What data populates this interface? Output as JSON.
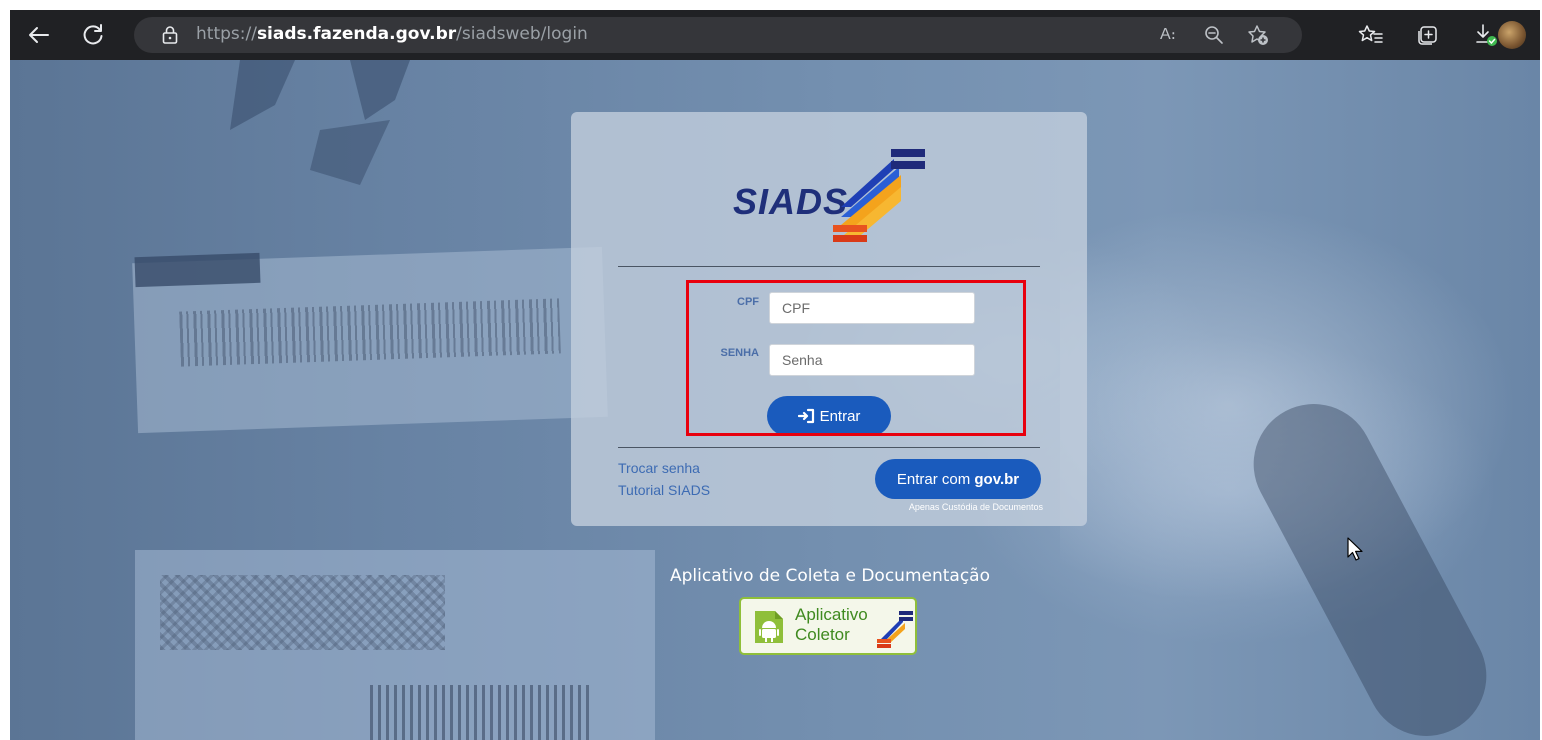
{
  "browser": {
    "url_scheme": "https://",
    "url_host": "siads.fazenda.gov.br",
    "url_path": "/siadsweb/login",
    "icons": {
      "back": "arrow-left-icon",
      "reload": "reload-icon",
      "lock": "lock-icon",
      "read_aloud": "read-aloud-icon",
      "zoom": "zoom-out-icon",
      "add_favorite": "star-plus-icon",
      "favorites": "favorites-icon",
      "collections": "collections-icon",
      "downloads": "download-icon",
      "profile": "profile-avatar"
    },
    "read_aloud_glyph": "A։",
    "colors": {
      "toolbar": "#202124",
      "url_bar": "#35363a"
    }
  },
  "login": {
    "logo_text": "SIADS",
    "cpf_label": "CPF",
    "cpf_placeholder": "CPF",
    "senha_label": "SENHA",
    "senha_placeholder": "Senha",
    "entrar_label": "Entrar",
    "trocar_senha": "Trocar senha",
    "tutorial": "Tutorial SIADS",
    "govbr_prefix": "Entrar com ",
    "govbr_bold": "gov.br",
    "govbr_note": "Apenas Custódia de Documentos",
    "colors": {
      "primary_button": "#1a5bbd",
      "highlight": "#e8000d",
      "link": "#3d6bb3"
    }
  },
  "app": {
    "title": "Aplicativo de Coleta e Documentação",
    "badge_line1": "Aplicativo",
    "badge_line2": "Coletor",
    "colors": {
      "badge_border": "#8fbf3a",
      "badge_text": "#3f8a1f"
    }
  }
}
